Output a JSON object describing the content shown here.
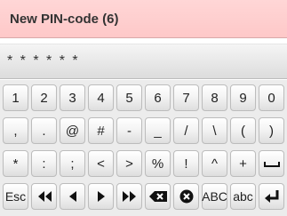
{
  "title": "New PIN-code (6)",
  "pin_display": "* * * * * *",
  "rows": [
    {
      "keys": [
        {
          "name": "key-1",
          "label": "1"
        },
        {
          "name": "key-2",
          "label": "2"
        },
        {
          "name": "key-3",
          "label": "3"
        },
        {
          "name": "key-4",
          "label": "4"
        },
        {
          "name": "key-5",
          "label": "5"
        },
        {
          "name": "key-6",
          "label": "6"
        },
        {
          "name": "key-7",
          "label": "7"
        },
        {
          "name": "key-8",
          "label": "8"
        },
        {
          "name": "key-9",
          "label": "9"
        },
        {
          "name": "key-0",
          "label": "0"
        }
      ]
    },
    {
      "keys": [
        {
          "name": "key-comma",
          "label": ","
        },
        {
          "name": "key-period",
          "label": "."
        },
        {
          "name": "key-at",
          "label": "@"
        },
        {
          "name": "key-hash",
          "label": "#"
        },
        {
          "name": "key-hyphen",
          "label": "-"
        },
        {
          "name": "key-underscore",
          "label": "_"
        },
        {
          "name": "key-slash",
          "label": "/"
        },
        {
          "name": "key-backslash",
          "label": "\\"
        },
        {
          "name": "key-open-paren",
          "label": "("
        },
        {
          "name": "key-close-paren",
          "label": ")"
        }
      ]
    },
    {
      "keys": [
        {
          "name": "key-asterisk",
          "label": "*"
        },
        {
          "name": "key-colon",
          "label": ":"
        },
        {
          "name": "key-semicolon",
          "label": ";"
        },
        {
          "name": "key-less-than",
          "label": "<"
        },
        {
          "name": "key-greater-than",
          "label": ">"
        },
        {
          "name": "key-percent",
          "label": "%"
        },
        {
          "name": "key-exclamation",
          "label": "!"
        },
        {
          "name": "key-caret",
          "label": "^"
        },
        {
          "name": "key-plus",
          "label": "+"
        },
        {
          "name": "key-space",
          "label": "",
          "icon": "space-icon"
        }
      ]
    },
    {
      "keys": [
        {
          "name": "key-esc",
          "label": "Esc"
        },
        {
          "name": "key-home",
          "label": "",
          "icon": "double-left-arrow-icon"
        },
        {
          "name": "key-left",
          "label": "",
          "icon": "left-arrow-icon"
        },
        {
          "name": "key-right",
          "label": "",
          "icon": "right-arrow-icon"
        },
        {
          "name": "key-end",
          "label": "",
          "icon": "double-right-arrow-icon"
        },
        {
          "name": "key-backspace",
          "label": "",
          "icon": "backspace-icon"
        },
        {
          "name": "key-clear",
          "label": "",
          "icon": "clear-circle-icon"
        },
        {
          "name": "key-uppercase-mode",
          "label": "ABC"
        },
        {
          "name": "key-lowercase-mode",
          "label": "abc"
        },
        {
          "name": "key-enter",
          "label": "",
          "icon": "enter-icon"
        }
      ]
    }
  ]
}
